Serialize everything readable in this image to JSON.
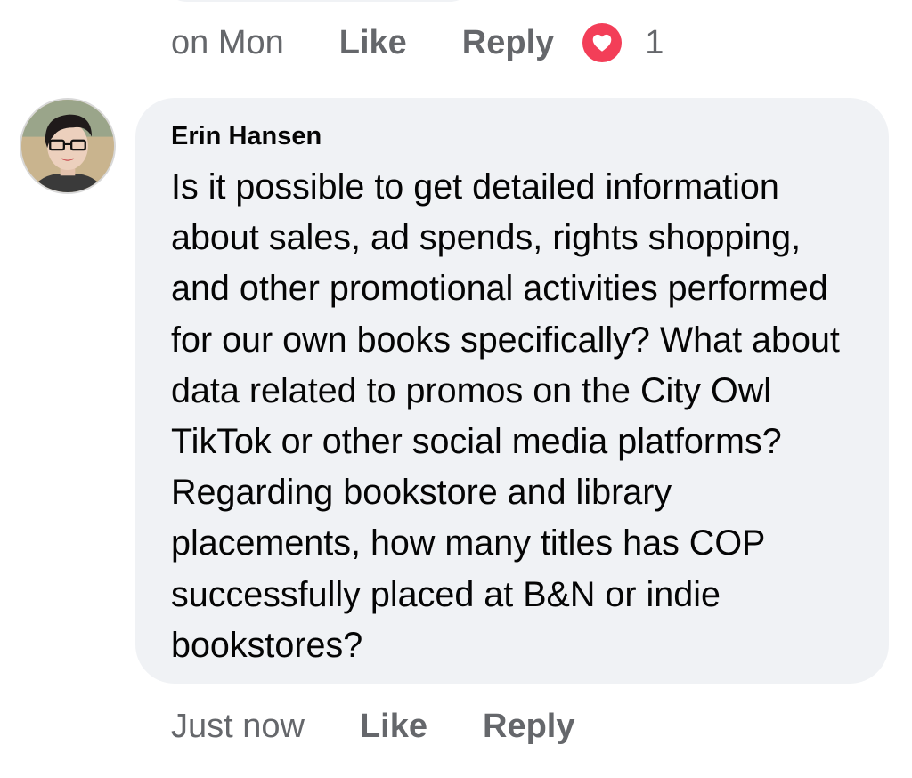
{
  "previous_comment": {
    "time": "on Mon",
    "like_label": "Like",
    "reply_label": "Reply",
    "reaction_icon": "heart-icon",
    "reaction_count": "1",
    "reaction_color": "#f33e58"
  },
  "comment": {
    "author": "Erin Hansen",
    "avatar_icon": "user-avatar",
    "text": "Is it possible to get detailed information about sales, ad spends, rights shopping, and other promotional activities performed for our own books specifically? What about data related to promos on the City Owl TikTok or other social media platforms? Regarding bookstore and library placements, how many titles has COP successfully placed at B&N or indie bookstores?",
    "time": "Just now",
    "like_label": "Like",
    "reply_label": "Reply"
  },
  "colors": {
    "bubble_bg": "#f0f2f5",
    "secondary_text": "#65676b",
    "primary_text": "#050505"
  }
}
